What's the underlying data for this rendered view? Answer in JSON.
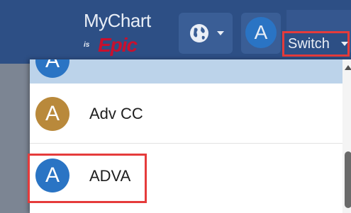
{
  "header": {
    "logo": {
      "brand": "MyChart",
      "tagline": "is",
      "vendor": "Epic"
    },
    "language_icon": "globe-icon",
    "profile_initial": "A",
    "switch_label": "Switch"
  },
  "dropdown": {
    "items": [
      {
        "initial": "A",
        "name": "",
        "avatar_color": "#2a74c4",
        "highlighted": true
      },
      {
        "initial": "A",
        "name": "Adv CC",
        "avatar_color": "#b9893b"
      },
      {
        "initial": "A",
        "name": "ADVA",
        "avatar_color": "#2a74c4",
        "annotated": true
      }
    ]
  },
  "colors": {
    "header_bg": "#2d4f85",
    "annotation_red": "#e53b3b",
    "selected_row": "#bcd3ea"
  }
}
